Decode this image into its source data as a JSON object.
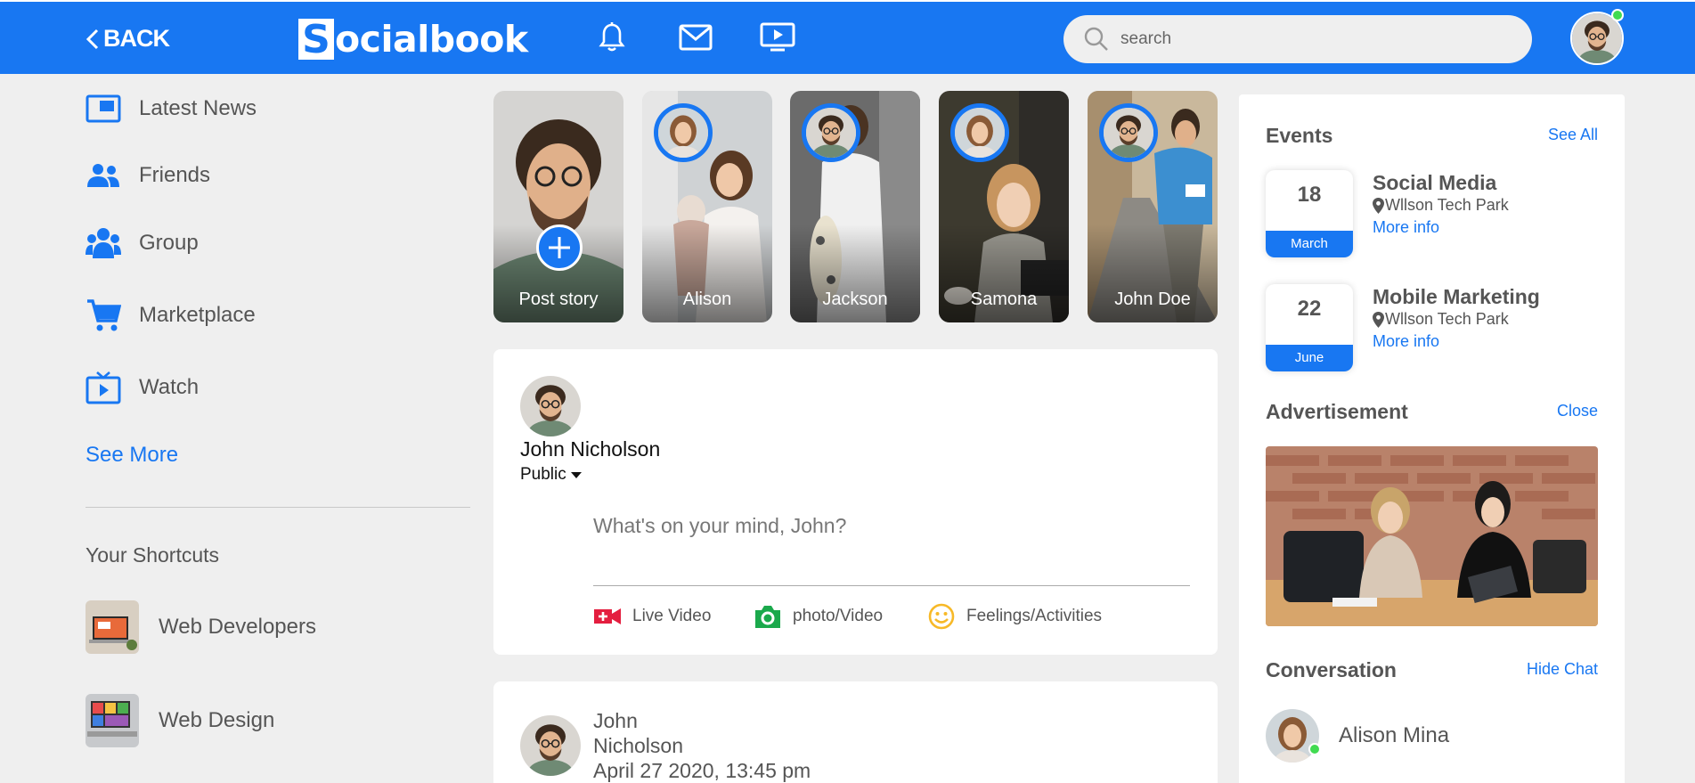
{
  "header": {
    "back_label": "BACK",
    "logo_letter": "S",
    "logo_rest": "ocialbook",
    "search_placeholder": "search",
    "icons": [
      "bell-icon",
      "mail-icon",
      "video-icon"
    ],
    "accent": "#1877f2"
  },
  "sidebar": {
    "items": [
      {
        "label": "Latest News",
        "icon": "news-icon"
      },
      {
        "label": "Friends",
        "icon": "friends-icon"
      },
      {
        "label": "Group",
        "icon": "group-icon"
      },
      {
        "label": "Marketplace",
        "icon": "cart-icon"
      },
      {
        "label": "Watch",
        "icon": "tv-icon"
      }
    ],
    "see_more": "See More",
    "shortcuts_title": "Your Shortcuts",
    "shortcuts": [
      {
        "label": "Web Developers"
      },
      {
        "label": "Web Design"
      }
    ]
  },
  "stories": [
    {
      "name": "Post story"
    },
    {
      "name": "Alison"
    },
    {
      "name": "Jackson"
    },
    {
      "name": "Samona"
    },
    {
      "name": "John Doe"
    }
  ],
  "create_post": {
    "user_name": "John Nicholson",
    "privacy": "Public",
    "placeholder": "What's on your mind, John?",
    "actions": [
      {
        "label": "Live Video",
        "icon": "live-video-icon",
        "color": "#e41e3f"
      },
      {
        "label": "photo/Video",
        "icon": "camera-icon",
        "color": "#1ba94c"
      },
      {
        "label": "Feelings/Activities",
        "icon": "smiley-icon",
        "color": "#f7b928"
      }
    ]
  },
  "post": {
    "author_first": "John",
    "author_last": "Nicholson",
    "date": "April 27 2020, 13:45 pm"
  },
  "events": {
    "title": "Events",
    "see_all": "See All",
    "items": [
      {
        "day": "18",
        "month": "March",
        "title": "Social Media",
        "location": "Wllson Tech Park",
        "more": "More info"
      },
      {
        "day": "22",
        "month": "June",
        "title": "Mobile Marketing",
        "location": "Wllson Tech Park",
        "more": "More info"
      }
    ]
  },
  "advertisement": {
    "title": "Advertisement",
    "close": "Close"
  },
  "conversation": {
    "title": "Conversation",
    "hide": "Hide Chat",
    "contacts": [
      {
        "name": "Alison Mina",
        "online": true
      }
    ]
  }
}
